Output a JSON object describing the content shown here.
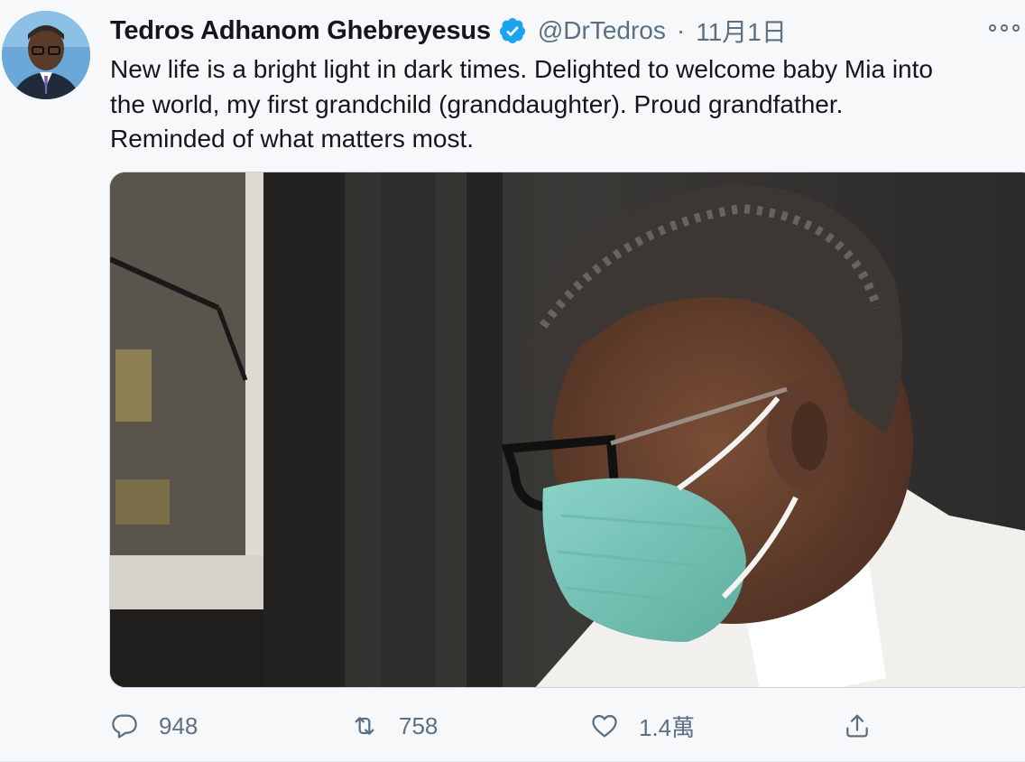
{
  "author": {
    "name": "Tedros Adhanom Ghebreyesus",
    "handle": "@DrTedros",
    "separator": "·",
    "date": "11月1日",
    "verified": true
  },
  "tweet": {
    "lines": [
      "New life is a bright light in dark times. Delighted to welcome baby Mia into",
      "the world, my first grandchild (granddaughter). Proud grandfather.",
      "Reminded of what matters most."
    ]
  },
  "actions": {
    "reply_count": "948",
    "retweet_count": "758",
    "like_count": "1.4萬"
  },
  "icons": {
    "verified": "verified-badge-icon",
    "more": "more-options-icon",
    "reply": "reply-icon",
    "retweet": "retweet-icon",
    "like": "heart-icon",
    "share": "share-icon"
  },
  "colors": {
    "verified_blue": "#1da1f2",
    "secondary_text": "#5b7083",
    "mask": "#7fc7bf"
  }
}
